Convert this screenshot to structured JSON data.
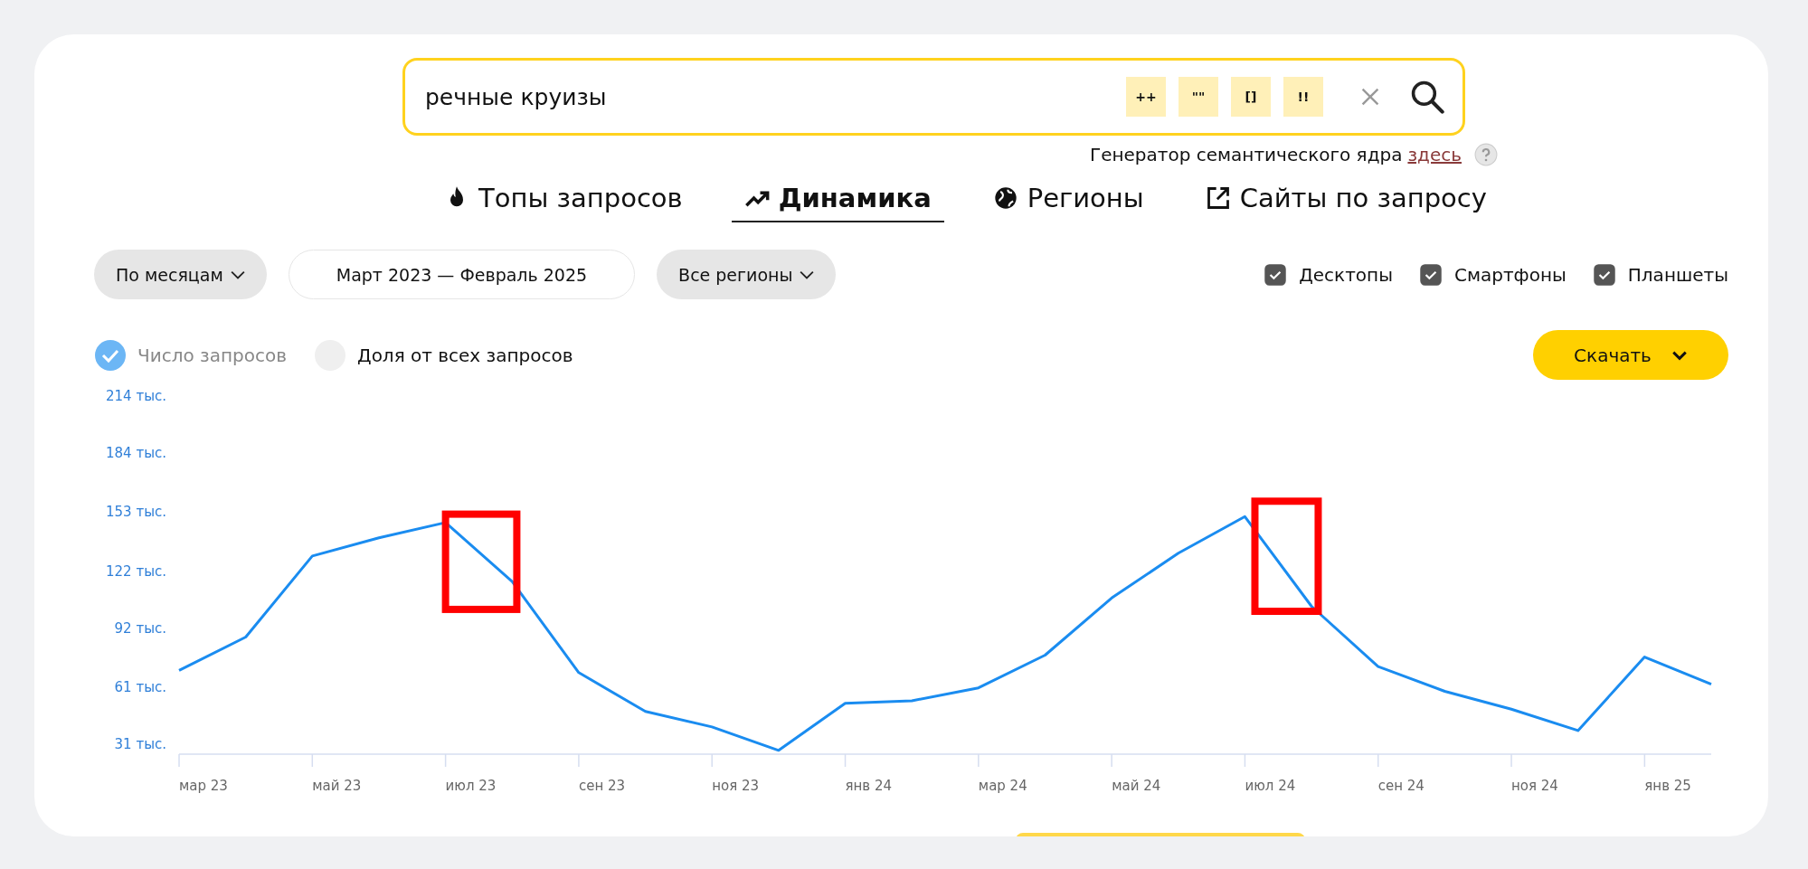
{
  "search": {
    "value": "речные круизы",
    "operators": [
      "++",
      "\"\"",
      "[]",
      "!!"
    ]
  },
  "generator": {
    "text": "Генератор семантического ядра",
    "link": "здесь"
  },
  "tabs": [
    {
      "label": "Топы запросов",
      "selected": false
    },
    {
      "label": "Динамика",
      "selected": true
    },
    {
      "label": "Регионы",
      "selected": false
    },
    {
      "label": "Сайты по запросу",
      "selected": false
    }
  ],
  "filters": {
    "period": "По месяцам",
    "range": "Март 2023 — Февраль 2025",
    "region": "Все регионы"
  },
  "devices": [
    {
      "label": "Десктопы",
      "checked": true
    },
    {
      "label": "Смартфоны",
      "checked": true
    },
    {
      "label": "Планшеты",
      "checked": true
    }
  ],
  "modes": [
    {
      "label": "Число запросов",
      "selected": true
    },
    {
      "label": "Доля от всех запросов",
      "selected": false
    }
  ],
  "download": {
    "label": "Скачать"
  },
  "chart_data": {
    "type": "line",
    "categories": [
      "мар 23",
      null,
      "май 23",
      null,
      "июл 23",
      null,
      "сен 23",
      null,
      "ноя 23",
      null,
      "янв 24",
      null,
      "мар 24",
      null,
      "май 24",
      null,
      "июл 24",
      null,
      "сен 24",
      null,
      "ноя 24",
      null,
      "янв 25",
      null
    ],
    "series": [
      {
        "color": "#1a8cf0",
        "values": [
          70,
          87.5,
          130,
          139.6,
          147.6,
          116.6,
          68.8,
          48.4,
          40.3,
          28,
          52.7,
          54,
          60.8,
          78,
          108,
          131.5,
          150.7,
          103.6,
          72,
          59,
          49.6,
          38.4,
          77,
          62.7
        ]
      }
    ],
    "ylim": [
      26,
      214
    ],
    "yticks": [
      {
        "value": 31,
        "label": "31 тыс."
      },
      {
        "value": 61,
        "label": "61 тыс."
      },
      {
        "value": 92,
        "label": "92 тыс."
      },
      {
        "value": 122,
        "label": "122 тыс."
      },
      {
        "value": 153,
        "label": "153 тыс."
      },
      {
        "value": 184,
        "label": "184 тыс."
      },
      {
        "value": 214,
        "label": "214 тыс."
      }
    ]
  }
}
